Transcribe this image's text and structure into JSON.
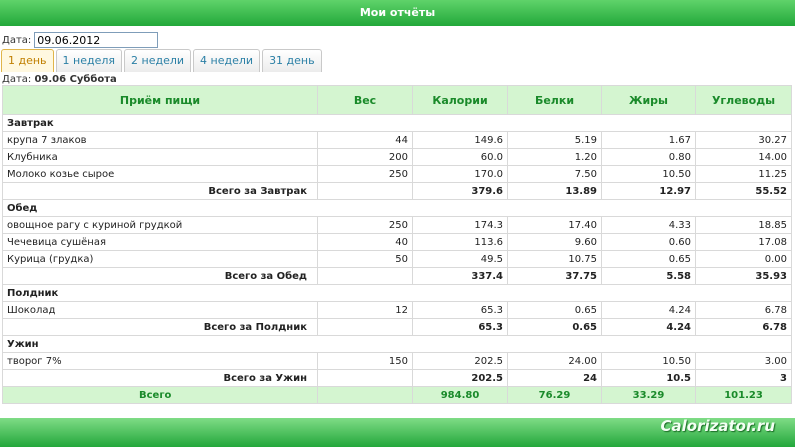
{
  "header": {
    "title": "Мои отчёты"
  },
  "date_field": {
    "label": "Дата:",
    "value": "09.06.2012"
  },
  "tabs": [
    {
      "label": "1 день",
      "active": true
    },
    {
      "label": "1 неделя",
      "active": false
    },
    {
      "label": "2 недели",
      "active": false
    },
    {
      "label": "4 недели",
      "active": false
    },
    {
      "label": "31 день",
      "active": false
    }
  ],
  "report_date": {
    "label": "Дата:",
    "value": "09.06 Суббота"
  },
  "table": {
    "columns": [
      "Приём пищи",
      "Вес",
      "Калории",
      "Белки",
      "Жиры",
      "Углеводы"
    ],
    "meals": [
      {
        "name": "Завтрак",
        "items": [
          [
            "крупа 7 злаков",
            "44",
            "149.6",
            "5.19",
            "1.67",
            "30.27"
          ],
          [
            "Клубника",
            "200",
            "60.0",
            "1.20",
            "0.80",
            "14.00"
          ],
          [
            "Молоко козье сырое",
            "250",
            "170.0",
            "7.50",
            "10.50",
            "11.25"
          ]
        ],
        "subtotal": [
          "Всего за Завтрак",
          "",
          "379.6",
          "13.89",
          "12.97",
          "55.52"
        ]
      },
      {
        "name": "Обед",
        "items": [
          [
            "овощное рагу с куриной грудкой",
            "250",
            "174.3",
            "17.40",
            "4.33",
            "18.85"
          ],
          [
            "Чечевица сушёная",
            "40",
            "113.6",
            "9.60",
            "0.60",
            "17.08"
          ],
          [
            "Курица (грудка)",
            "50",
            "49.5",
            "10.75",
            "0.65",
            "0.00"
          ]
        ],
        "subtotal": [
          "Всего за Обед",
          "",
          "337.4",
          "37.75",
          "5.58",
          "35.93"
        ]
      },
      {
        "name": "Полдник",
        "items": [
          [
            "Шоколад",
            "12",
            "65.3",
            "0.65",
            "4.24",
            "6.78"
          ]
        ],
        "subtotal": [
          "Всего за Полдник",
          "",
          "65.3",
          "0.65",
          "4.24",
          "6.78"
        ]
      },
      {
        "name": "Ужин",
        "items": [
          [
            "творог 7%",
            "150",
            "202.5",
            "24.00",
            "10.50",
            "3.00"
          ]
        ],
        "subtotal": [
          "Всего за Ужин",
          "",
          "202.5",
          "24",
          "10.5",
          "3"
        ]
      }
    ],
    "total": [
      "Всего",
      "",
      "984.80",
      "76.29",
      "33.29",
      "101.23"
    ]
  },
  "watermark": "Calorizator.ru"
}
